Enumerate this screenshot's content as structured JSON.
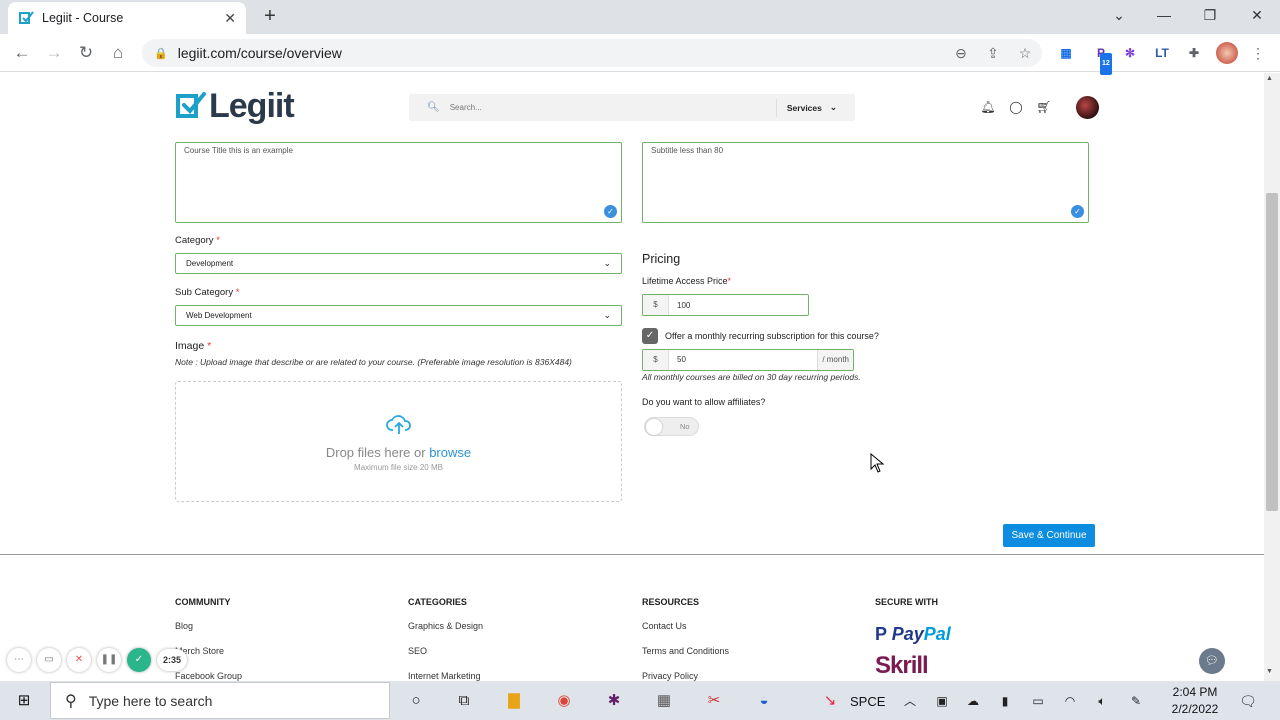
{
  "browser": {
    "tab_title": "Legiit - Course",
    "url": "legiit.com/course/overview",
    "ext_badge": "12",
    "ext_lt": "LT"
  },
  "header": {
    "logo_text": "Legiit",
    "search_placeholder": "Search...",
    "services_label": "Services"
  },
  "form": {
    "title_value": "Course Title this is an example",
    "subtitle_value": "Subtitle less than 80",
    "category_label": "Category",
    "category_value": "Development",
    "subcategory_label": "Sub Category",
    "subcategory_value": "Web Development",
    "image_label": "Image",
    "required_mark": "*",
    "image_note": "Note : Upload image that describe or are related to your course. (Preferable image resolution is 836X484)",
    "drop_text": "Drop files here or",
    "browse_text": "browse",
    "max_size": "Maximum file size 20 MB"
  },
  "pricing": {
    "heading": "Pricing",
    "lifetime_label": "Lifetime Access Price",
    "currency": "$",
    "lifetime_value": "100",
    "subscription_label": "Offer a monthly recurring subscription for this course?",
    "subscription_checked": true,
    "monthly_value": "50",
    "per_month": "/ month",
    "billing_note": "All monthly courses are billed on 30 day recurring periods.",
    "affiliates_label": "Do you want to allow affiliates?",
    "affiliates_toggle": "No"
  },
  "actions": {
    "save_label": "Save & Continue"
  },
  "footer": {
    "columns": [
      {
        "heading": "COMMUNITY",
        "links": [
          "Blog",
          "Merch Store",
          "Facebook Group"
        ]
      },
      {
        "heading": "CATEGORIES",
        "links": [
          "Graphics & Design",
          "SEO",
          "Internet Marketing"
        ]
      },
      {
        "heading": "RESOURCES",
        "links": [
          "Contact Us",
          "Terms and Conditions",
          "Privacy Policy"
        ]
      },
      {
        "heading": "SECURE WITH",
        "links": []
      }
    ],
    "paypal_a": "Pay",
    "paypal_b": "Pal",
    "skrill": "Skrill"
  },
  "recorder": {
    "timer": "2:35"
  },
  "taskbar": {
    "search_placeholder": "Type here to search",
    "stock": "SPCE",
    "time": "2:04 PM",
    "date": "2/2/2022"
  }
}
